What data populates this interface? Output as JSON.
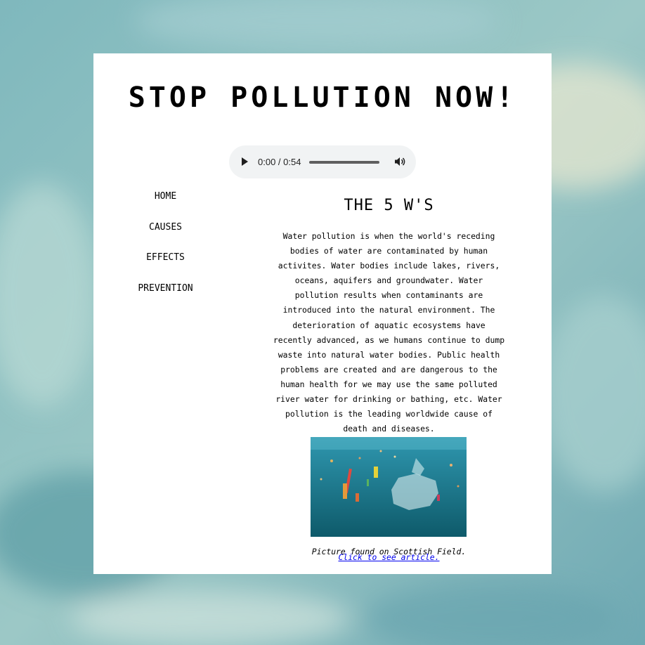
{
  "header": {
    "title": "STOP POLLUTION NOW!"
  },
  "audio_player": {
    "time_display": "0:00 / 0:54",
    "progress": 0,
    "play_icon": "play-icon",
    "volume_icon": "volume-icon"
  },
  "nav": {
    "items": [
      {
        "label": "HOME"
      },
      {
        "label": "CAUSES"
      },
      {
        "label": "EFFECTS"
      },
      {
        "label": "PREVENTION"
      }
    ]
  },
  "main": {
    "heading": "THE 5 W'S",
    "body": "Water pollution is when the world's receding bodies of water are contaminated by human activites. Water bodies include lakes, rivers, oceans, aquifers and groundwater. Water pollution results when contaminants are introduced into the natural environment. The deterioration of aquatic ecosystems have recently advanced, as we humans continue to dump waste into natural water bodies. Public health problems are created and are dangerous to the human health for we may use the same polluted river water for drinking or bathing, etc. Water pollution is the leading worldwide cause of death and diseases.",
    "caption": "Picture found on Scottish Field.",
    "link_text": "Click to see article."
  },
  "colors": {
    "background": "#8fc0c2",
    "card": "#ffffff",
    "link": "#0000ee",
    "player_bg": "#f1f3f4"
  }
}
